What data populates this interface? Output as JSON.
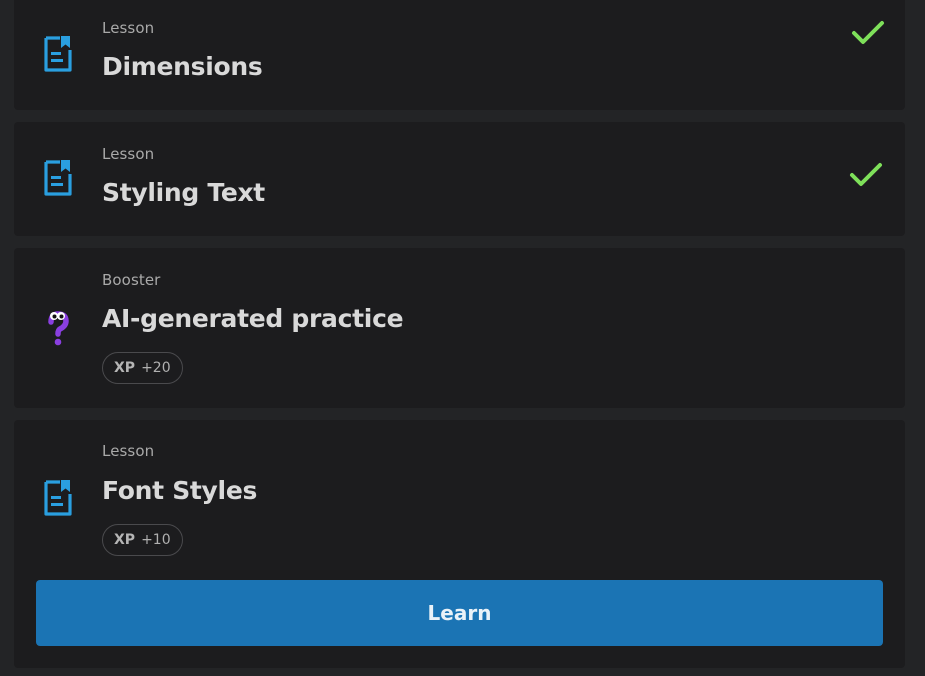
{
  "items": [
    {
      "kind": "Lesson",
      "title": "Dimensions",
      "icon": "lesson-doc-icon",
      "completed": true
    },
    {
      "kind": "Lesson",
      "title": "Styling Text",
      "icon": "lesson-doc-icon",
      "completed": true
    },
    {
      "kind": "Booster",
      "title": "AI-generated practice",
      "icon": "question-mascot-icon",
      "xp_label": "XP",
      "xp_value": "+20"
    },
    {
      "kind": "Lesson",
      "title": "Font Styles",
      "icon": "lesson-doc-icon",
      "xp_label": "XP",
      "xp_value": "+10",
      "button_label": "Learn"
    }
  ],
  "colors": {
    "accent": "#1b74b4",
    "lesson_icon": "#2a9fe0",
    "check": "#7ee05a",
    "booster_icon": "#8a3fe0"
  }
}
